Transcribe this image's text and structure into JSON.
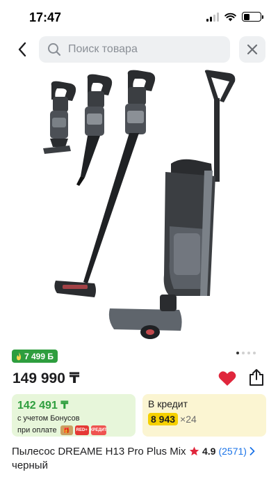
{
  "status_bar": {
    "time": "17:47"
  },
  "header": {
    "search_placeholder": "Поиск товара",
    "icons": {
      "back": "chevron-left-icon",
      "search": "search-icon",
      "close": "close-icon"
    }
  },
  "gallery": {
    "image_alt": "DREAME H13 Pro Plus Mix vacuum cleaner set",
    "slides_total": 4,
    "active_slide": 1
  },
  "pricing": {
    "bonus_badge": "7 499 Б",
    "price": "149 990 ₸"
  },
  "bonus_card": {
    "amount": "142 491 ₸",
    "line1": "с учетом Бонусов",
    "line2": "при оплате",
    "badges": [
      "",
      "RED+",
      "КРЕДИТ"
    ]
  },
  "credit_card": {
    "label": "В кредит",
    "monthly": "8 943",
    "months": "×24"
  },
  "product": {
    "title": "Пылесос DREAME H13 Pro Plus Mix черный",
    "rating": "4.9",
    "reviews": "(2571)"
  },
  "colors": {
    "accent_green": "#2e9e3e",
    "heart_red": "#e0263c",
    "link_blue": "#1a73e8",
    "credit_yellow": "#f5d000"
  }
}
